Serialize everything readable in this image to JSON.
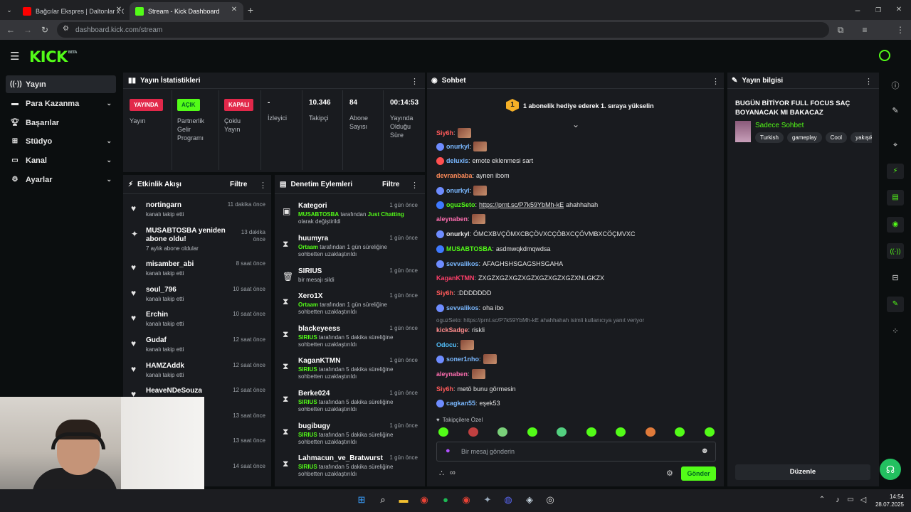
{
  "browser": {
    "tabs": [
      {
        "label": "Bağcılar Ekspres | Daltonlar x Ca"
      },
      {
        "label": "Stream - Kick Dashboard"
      }
    ],
    "url": "dashboard.kick.com/stream"
  },
  "nav": {
    "items": [
      {
        "label": "Yayın"
      },
      {
        "label": "Para Kazanma"
      },
      {
        "label": "Başarılar"
      },
      {
        "label": "Stüdyo"
      },
      {
        "label": "Kanal"
      },
      {
        "label": "Ayarlar"
      }
    ]
  },
  "stats": {
    "title": "Yayın İstatistikleri",
    "items": [
      {
        "badge": "YAYINDA",
        "label": "Yayın"
      },
      {
        "badge": "AÇIK",
        "label": "Partnerlik Gelir Programı"
      },
      {
        "badge": "KAPALI",
        "label": "Çoklu Yayın"
      },
      {
        "value": "-",
        "label": "İzleyici"
      },
      {
        "value": "10.346",
        "label": "Takipçi"
      },
      {
        "value": "84",
        "label": "Abone Sayısı"
      },
      {
        "value": "00:14:53",
        "label": "Yayında Olduğu Süre"
      }
    ]
  },
  "activity": {
    "title": "Etkinlik Akışı",
    "filter": "Filtre",
    "rows": [
      {
        "name": "nortingarn",
        "sub": "kanalı takip etti",
        "time": "11 dakika önce"
      },
      {
        "name": "MUSABTOSBA yeniden abone oldu!",
        "sub": "7 aylık abone oldular",
        "time": "13 dakika önce"
      },
      {
        "name": "misamber_abi",
        "sub": "kanalı takip etti",
        "time": "8 saat önce"
      },
      {
        "name": "soul_796",
        "sub": "kanalı takip etti",
        "time": "10 saat önce"
      },
      {
        "name": "Erchin",
        "sub": "kanalı takip etti",
        "time": "10 saat önce"
      },
      {
        "name": "Gudaf",
        "sub": "kanalı takip etti",
        "time": "12 saat önce"
      },
      {
        "name": "HAMZAddk",
        "sub": "kanalı takip etti",
        "time": "12 saat önce"
      },
      {
        "name": "HeaveNDeSouza",
        "sub": "",
        "time": "12 saat önce"
      },
      {
        "name": "",
        "sub": "",
        "time": "13 saat önce"
      },
      {
        "name": "",
        "sub": "",
        "time": "13 saat önce"
      },
      {
        "name": "",
        "sub": "",
        "time": "14 saat önce"
      }
    ]
  },
  "moderation": {
    "title": "Denetim Eylemleri",
    "filter": "Filtre",
    "rows": [
      {
        "name": "Kategori",
        "actor": "MUSABTOSBA",
        "mid": " tarafından ",
        "target": "Just Chatting",
        "rest": " olarak değiştirildi",
        "time": "1 gün önce"
      },
      {
        "name": "huumyra",
        "actor": "Ortaam",
        "mid": " tarafından 1 gün süreliğine sohbetten uzaklaştırıldı",
        "target": "",
        "rest": "",
        "time": "1 gün önce"
      },
      {
        "name": "SIRIUS",
        "actor": "",
        "mid": "bir mesajı sildi",
        "target": "",
        "rest": "",
        "time": "1 gün önce"
      },
      {
        "name": "Xero1X",
        "actor": "Ortaam",
        "mid": " tarafından 1 gün süreliğine sohbetten uzaklaştırıldı",
        "target": "",
        "rest": "",
        "time": "1 gün önce"
      },
      {
        "name": "blackeyeess",
        "actor": "SIRIUS",
        "mid": " tarafından 5 dakika süreliğine sohbetten uzaklaştırıldı",
        "target": "",
        "rest": "",
        "time": "1 gün önce"
      },
      {
        "name": "KaganKTMN",
        "actor": "SIRIUS",
        "mid": " tarafından 5 dakika süreliğine sohbetten uzaklaştırıldı",
        "target": "",
        "rest": "",
        "time": "1 gün önce"
      },
      {
        "name": "Berke024",
        "actor": "SIRIUS",
        "mid": " tarafından 5 dakika süreliğine sohbetten uzaklaştırıldı",
        "target": "",
        "rest": "",
        "time": "1 gün önce"
      },
      {
        "name": "bugibugy",
        "actor": "SIRIUS",
        "mid": " tarafından 5 dakika süreliğine sohbetten uzaklaştırıldı",
        "target": "",
        "rest": "",
        "time": "1 gün önce"
      },
      {
        "name": "Lahmacun_ve_Bratwurst",
        "actor": "SIRIUS",
        "mid": " tarafından 5 dakika süreliğine sohbetten uzaklaştırıldı",
        "target": "",
        "rest": "",
        "time": "1 gün önce"
      }
    ]
  },
  "chat": {
    "title": "Sohbet",
    "banner_num": "1",
    "banner": "1 abonelik hediye ederek 1. sıraya yükselin",
    "messages": [
      {
        "user": "Siy6h",
        "text": "",
        "color": "#ff5a5a",
        "emote": true
      },
      {
        "user": "onurkyl",
        "text": "",
        "color": "#7ab8ff",
        "emote": true,
        "badge": "#6e8cff"
      },
      {
        "user": "deluxis",
        "text": "emote eklenmesi sart",
        "color": "#7ab8ff",
        "badge": "#ff5050"
      },
      {
        "user": "devranbaba",
        "text": "aynen ibom",
        "color": "#ff8c5a"
      },
      {
        "user": "onurkyl",
        "text": "",
        "color": "#7ab8ff",
        "emote": true,
        "badge": "#6e8cff"
      },
      {
        "user": "oguzSeto",
        "text": "ahahhahah",
        "link": "https://prnt.sc/P7k59YbMh-kE",
        "color": "#53fc18",
        "badge": "#3f79ff"
      },
      {
        "user": "aleynaben",
        "text": "",
        "color": "#ff6eb0",
        "emote": true
      },
      {
        "user": "onurkyl",
        "text": "ÖMCXBVÇÖMXCBÇÖVXCÇÖBXCÇÖVMBXCÖÇMVXC",
        "color": "#e6e6e6",
        "badge": "#6e8cff"
      },
      {
        "user": "MUSABTOSBA",
        "text": "asdmwqkdmqwdsa",
        "color": "#53fc18",
        "badge": "#3f79ff"
      },
      {
        "user": "sevvalikos",
        "text": "AFAGHSHSGAGSHSGAHA",
        "color": "#7ab8ff",
        "badge": "#6e8cff"
      },
      {
        "user": "KaganKTMN",
        "text": "ZXGZXGZXGZXGZXGZXGZXGZXNLGKZX",
        "color": "#ff3f6a"
      },
      {
        "user": "Siy6h",
        "text": ":DDDDDDD",
        "color": "#ff5a5a"
      },
      {
        "user": "sevvalikos",
        "text": "oha ibo",
        "color": "#7ab8ff",
        "badge": "#6e8cff"
      },
      {
        "user": "kickSadge",
        "text": "riskli",
        "color": "#ff8c8c"
      },
      {
        "user": "Odocu",
        "text": "",
        "color": "#53c2ff",
        "emote": true
      },
      {
        "user": "soner1nho",
        "text": "",
        "color": "#7ab8ff",
        "emote": true,
        "badge": "#6e8cff"
      },
      {
        "user": "aleynaben",
        "text": "",
        "color": "#ff6eb0",
        "emote": true
      },
      {
        "user": "Siy6h",
        "text": "metö bunu görmesin",
        "color": "#ff5a5a"
      },
      {
        "user": "cagkan55",
        "text": "eşek53",
        "color": "#7ab8ff",
        "badge": "#6e8cff"
      }
    ],
    "reply": "oguzSeto: https://prnt.sc/P7k59YbMh-kE ahahhahah isimli kullanıcıya yanıt veriyor",
    "followers_only": "Takipçilere Özel",
    "input_placeholder": "Bir mesaj gönderin",
    "send": "Gönder"
  },
  "info": {
    "title": "Yayın bilgisi",
    "stream_title": "BUGÜN BİTİYOR FULL FOCUS SAÇ BOYANACAK MI BAKACAZ",
    "category": "Sadece Sohbet",
    "tags": [
      "Turkish",
      "gameplay",
      "Cool",
      "yakışık"
    ],
    "edit": "Düzenle"
  },
  "taskbar": {
    "time": "14:54",
    "date": "28.07.2025"
  },
  "colors": {
    "brand": "#53fc18",
    "panel": "#191b1f",
    "bg": "#0b0e0f"
  }
}
